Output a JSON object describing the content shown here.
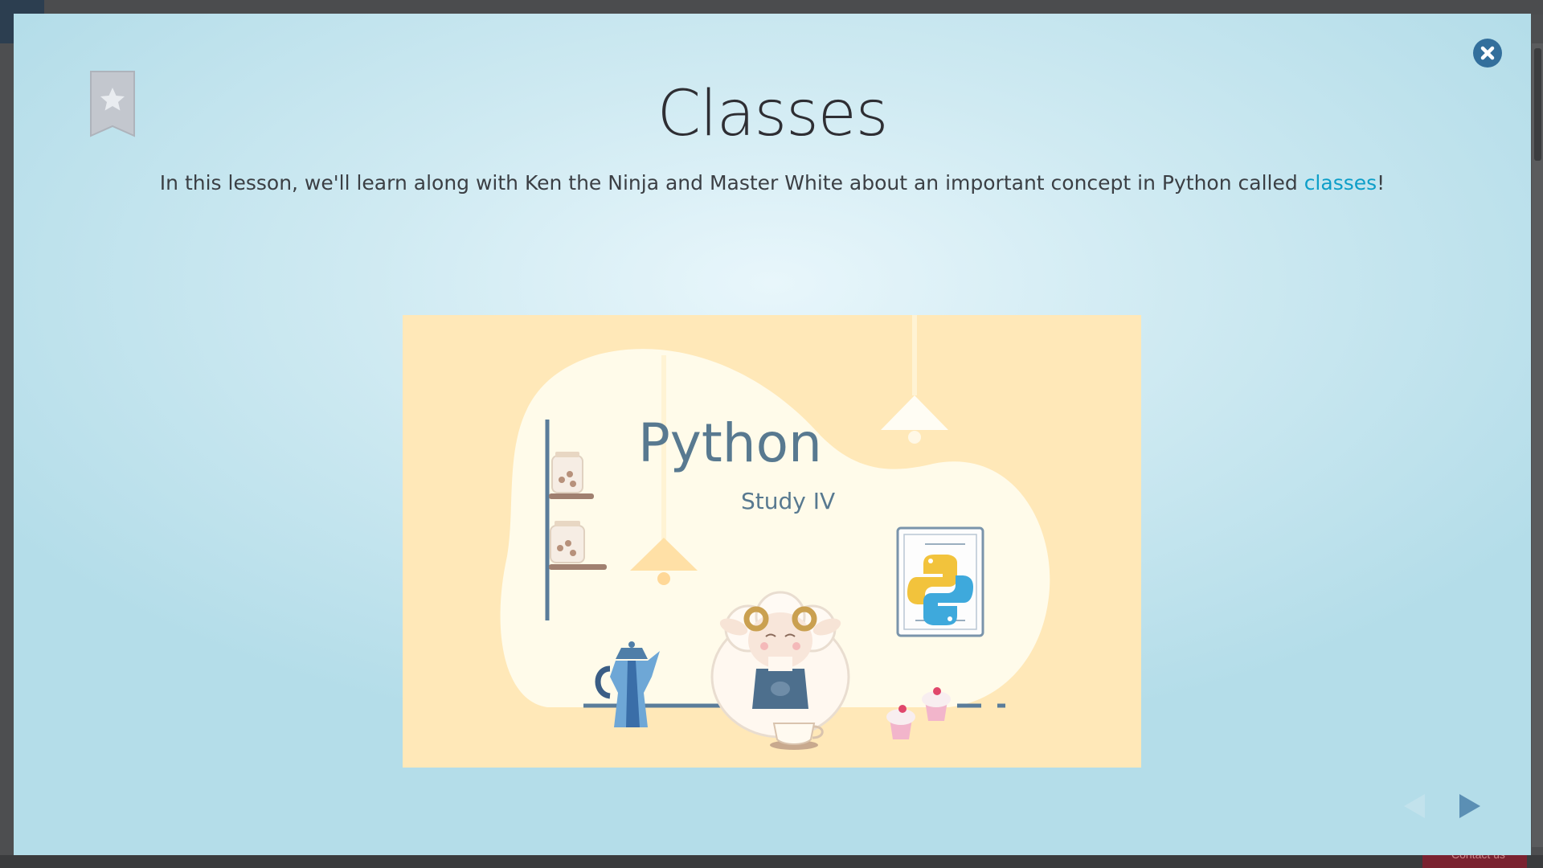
{
  "lesson": {
    "title": "Classes",
    "intro_before": "In this lesson, we'll learn along with Ken the Ninja and Master White about an important concept in Python called ",
    "intro_link": "classes",
    "intro_after": "!"
  },
  "illustration": {
    "heading": "Python",
    "subheading": "Study IV"
  },
  "background": {
    "contact_label": "Contact us"
  },
  "icons": {
    "bookmark": "bookmark-star-icon",
    "close": "close-icon",
    "prev": "arrow-left-icon",
    "next": "arrow-right-icon"
  },
  "colors": {
    "accent": "#0d9ec8",
    "close_button": "#336f9c",
    "nav_arrow": "#5b8fb4",
    "illustration_bg": "#ffe8b8"
  }
}
